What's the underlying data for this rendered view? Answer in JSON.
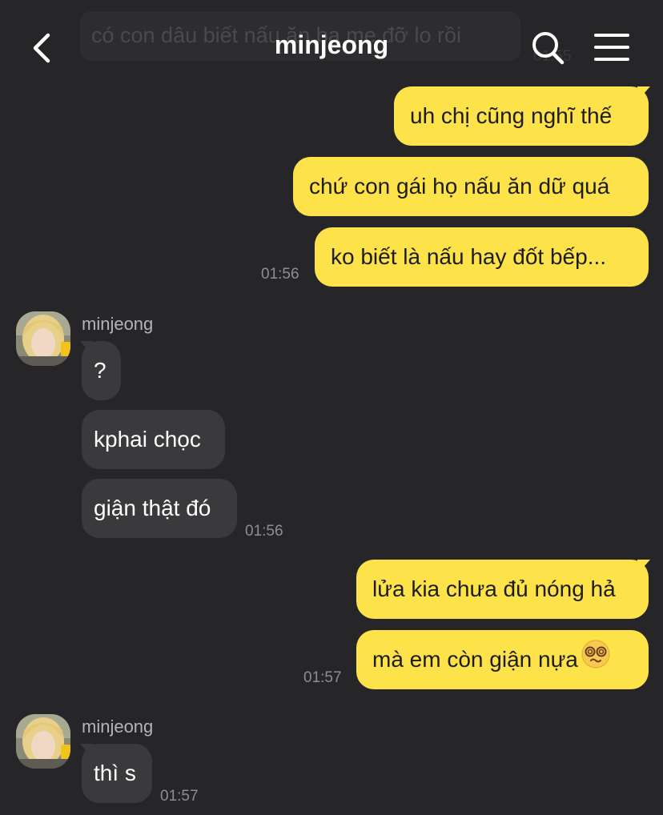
{
  "header": {
    "title": "minjeong",
    "ghost_text": "có con dâu biết nấu ăn ba mẹ đỡ lo rồi",
    "ghost_time": "01:55"
  },
  "messages": {
    "m1": "uh chị cũng nghĩ thế",
    "m2": "chứ con gái họ nấu ăn dữ quá",
    "m3": "ko biết là nấu hay đốt bếp...",
    "t1": "01:56",
    "sender1": "minjeong",
    "r1": "?",
    "r2": "kphai chọc",
    "r3": "giận thật đó",
    "t2": "01:56",
    "m4": "lửa kia chưa đủ nóng hả",
    "m5": "mà em còn giận nựa",
    "t3": "01:57",
    "sender2": "minjeong",
    "r4": "thì s",
    "t4": "01:57"
  },
  "icons": {
    "back": "chevron-left-icon",
    "search": "search-icon",
    "menu": "menu-icon",
    "emoji": "dizzy-face-emoji"
  },
  "colors": {
    "background": "#262628",
    "my_bubble": "#fde24a",
    "their_bubble": "#3a3a3c",
    "timestamp": "#8e8e92"
  }
}
